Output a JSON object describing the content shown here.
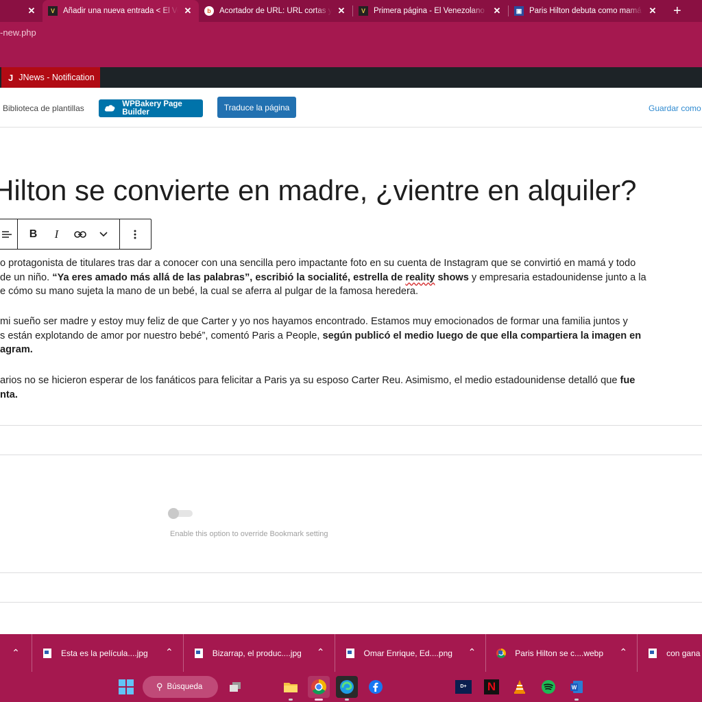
{
  "browser": {
    "tabs": [
      {
        "title": "",
        "active": false
      },
      {
        "title": "Añadir una nueva entrada < El Venezolano",
        "active": true
      },
      {
        "title": "Acortador de URL: URL cortas y a",
        "active": false
      },
      {
        "title": "Primera página - El Venezolano N",
        "active": false
      },
      {
        "title": "Paris Hilton debuta como mamá",
        "active": false
      }
    ],
    "url": "-new.php"
  },
  "adminbar": {
    "jnews_label": "JNews - Notification"
  },
  "editor_toolbar": {
    "templates_label": "Biblioteca de plantillas",
    "wpbakery_label": "WPBakery Page Builder",
    "translate_label": "Traduce la página",
    "save_label": "Guardar como"
  },
  "post": {
    "title": "Hilton se convierte en madre, ¿vientre en alquiler?",
    "p1": {
      "l1": "o protagonista de titulares tras dar a conocer con una sencilla pero impactante foto en su cuenta de Instagram que se convirtió en mamá y todo",
      "l2a": " de un niño. ",
      "l2b": "“Ya eres amado más allá de las palabras”, escribió la socialité, estrella de ",
      "l2c": "reality",
      "l2d": " shows",
      "l2e": " y empresaria estadounidense junto a la",
      "l3": "e cómo su mano sujeta la mano de un bebé, la cual se aferra al pulgar de la famosa heredera."
    },
    "p2": {
      "l1": "mi sueño ser madre y estoy muy feliz de que Carter y yo nos hayamos encontrado. Estamos muy emocionados de formar una familia juntos y",
      "l2a": "s están explotando de amor por nuestro bebé”, comentó Paris a People, ",
      "l2b": "según publicó el medio luego de que ella compartiera la imagen en",
      "l3": "agram."
    },
    "p3": {
      "l1a": "arios no se hicieron esperar de los fanáticos para felicitar a Paris ya su esposo Carter Reu. Asimismo, el medio estadounidense detalló que ",
      "l1b": "fue",
      "l2": "nta."
    }
  },
  "bookmark_option": {
    "help_text": "Enable this option to override Bookmark setting",
    "enabled": false
  },
  "downloads": [
    {
      "name": "Esta es la película....jpg"
    },
    {
      "name": "Bizarrap, el produc....jpg"
    },
    {
      "name": "Omar Enrique, Ed....png"
    },
    {
      "name": "Paris Hilton se c....webp"
    },
    {
      "name": "con gana"
    }
  ],
  "taskbar": {
    "search_label": "Búsqueda"
  },
  "colors": {
    "browser_frame": "#a5184f",
    "tab_strip": "#8a1042",
    "wp_blue": "#2271b1",
    "jnews_red": "#b10b14"
  }
}
